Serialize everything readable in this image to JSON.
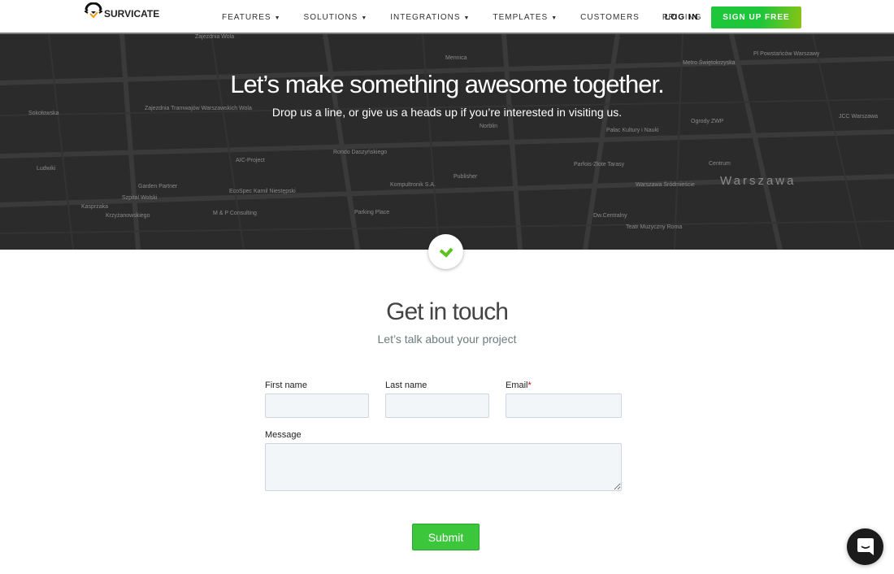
{
  "nav": {
    "logo": "SURVICATE",
    "items": [
      {
        "label": "FEATURES",
        "dropdown": true
      },
      {
        "label": "SOLUTIONS",
        "dropdown": true
      },
      {
        "label": "INTEGRATIONS",
        "dropdown": true
      },
      {
        "label": "TEMPLATES",
        "dropdown": true
      },
      {
        "label": "CUSTOMERS",
        "dropdown": false
      },
      {
        "label": "PRICING",
        "dropdown": false
      }
    ],
    "login": "LOG IN",
    "signup": "SIGN UP FREE"
  },
  "hero": {
    "title": "Let’s make something awesome together.",
    "subtitle": "Drop us a line, or give us a heads up if you’re interested in visiting us.",
    "map_labels": [
      "Zajezdnia Wola",
      "Sokołowska",
      "Zajezdnia Tramwajów Warszawskich Wola",
      "Rondo Daszyńskiego",
      "AIC-Project",
      "Garden Partner",
      "Szpital Wolski",
      "EcoSpec Kamil Niestępski",
      "M & P Consulting",
      "Parking Place",
      "Kompultronik S.A.",
      "Publisher",
      "Norblin",
      "Mennica",
      "Pałac Kultury i Nauki",
      "Parfois-Złote Tarasy",
      "Warszawa Śródmieście",
      "Warszawa",
      "Teatr Muzyczny Roma",
      "Ogrody ZWP",
      "Centrum",
      "JCC Warszawa",
      "Metro Świętokrzyska",
      "Pl Powstańców Warszawy",
      "Krzyżanowskiego",
      "Kasprzaka",
      "Ludwiki",
      "Dw.Centralny"
    ]
  },
  "form": {
    "title": "Get in touch",
    "subtitle": "Let’s talk about your project",
    "first_name": "First name",
    "last_name": "Last name",
    "email": "Email",
    "required_mark": "*",
    "message": "Message",
    "submit": "Submit"
  },
  "colors": {
    "accent": "#3bc63b",
    "hero_bg": "#2b2b2b"
  }
}
